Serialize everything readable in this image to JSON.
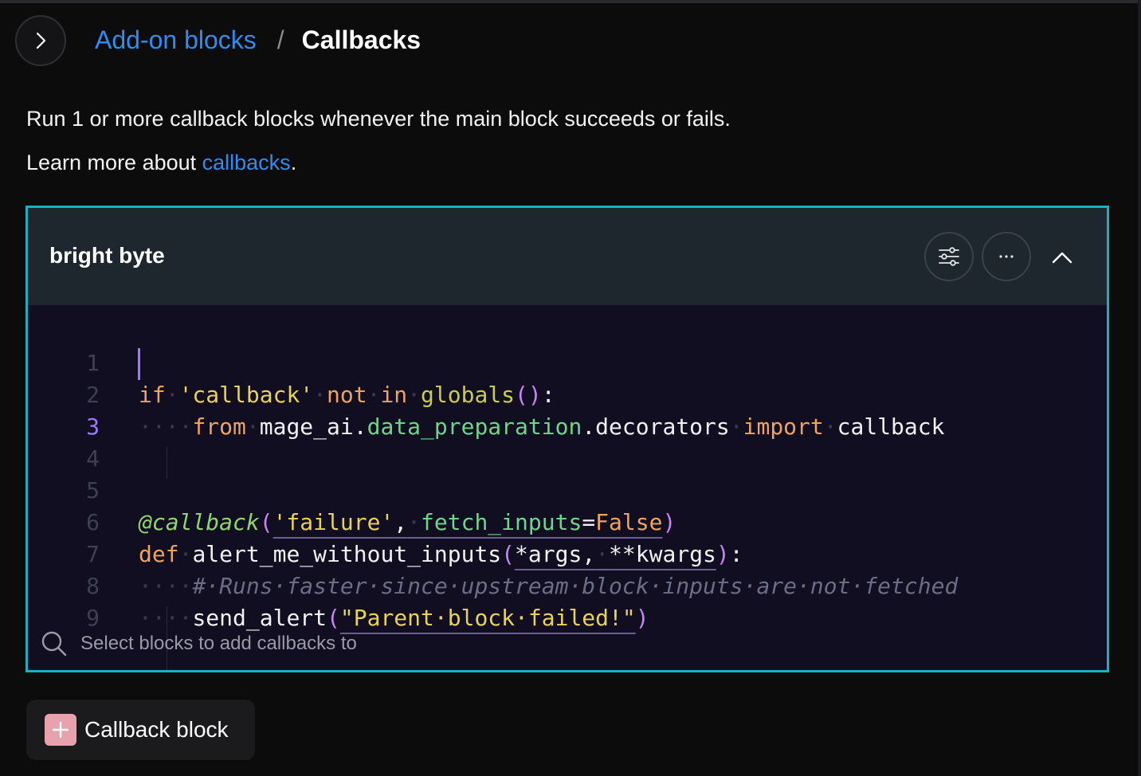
{
  "breadcrumb": {
    "parent": "Add-on blocks",
    "separator": "/",
    "current": "Callbacks"
  },
  "description": {
    "line1": "Run 1 or more callback blocks whenever the main block succeeds or fails.",
    "line2_prefix": "Learn more about ",
    "line2_link": "callbacks",
    "line2_suffix": "."
  },
  "card": {
    "title": "bright byte",
    "accent_color": "#18b1c4",
    "buttons": [
      "sliders-icon",
      "more-horizontal-icon",
      "chevron-up-icon"
    ],
    "code": {
      "active_line": 3,
      "lines": [
        {
          "n": "1",
          "text": "if 'callback' not in globals():"
        },
        {
          "n": "2",
          "text": "    from mage_ai.data_preparation.decorators import callback"
        },
        {
          "n": "3",
          "text": ""
        },
        {
          "n": "4",
          "text": ""
        },
        {
          "n": "5",
          "text": "@callback('failure', fetch_inputs=False)"
        },
        {
          "n": "6",
          "text": "def alert_me_without_inputs(*args, **kwargs):"
        },
        {
          "n": "7",
          "text": "    # Runs faster since upstream block inputs are not fetched"
        },
        {
          "n": "8",
          "text": "    send_alert(\"Parent block failed!\")"
        },
        {
          "n": "9",
          "text": ""
        }
      ]
    },
    "search": {
      "placeholder": "Select blocks to add callbacks to",
      "value": ""
    }
  },
  "add_button": {
    "label": "Callback block",
    "icon_color": "#e7a2ad"
  }
}
